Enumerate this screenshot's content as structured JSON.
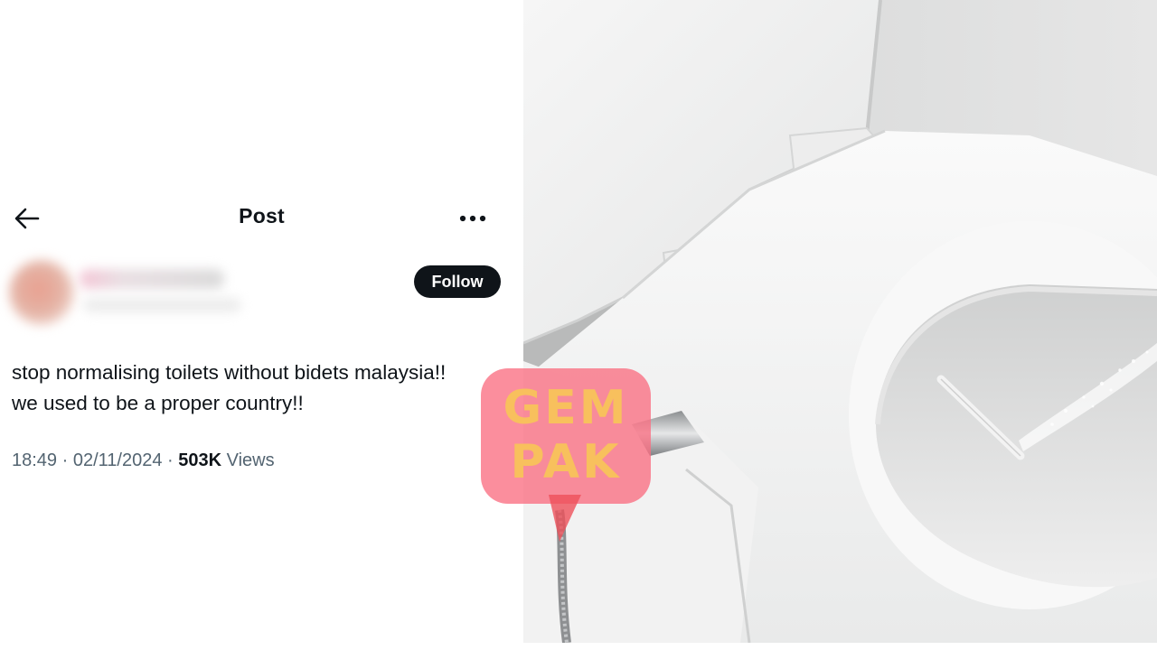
{
  "header": {
    "title": "Post",
    "back_icon": "arrow-left-icon",
    "more_icon": "more-horizontal-icon"
  },
  "author": {
    "follow_label": "Follow"
  },
  "post": {
    "lines": [
      "stop normalising toilets without bidets malaysia!!",
      "we used to be a proper country!!"
    ],
    "time": "18:49",
    "date": "02/11/2024",
    "views_count": "503K",
    "views_label": "Views"
  },
  "watermark": {
    "line1": "GEM",
    "line2": "PAK"
  },
  "colors": {
    "text_primary": "#0f1419",
    "text_secondary": "#536471",
    "follow_bg": "#0f1419",
    "watermark": "#fa6e82"
  }
}
